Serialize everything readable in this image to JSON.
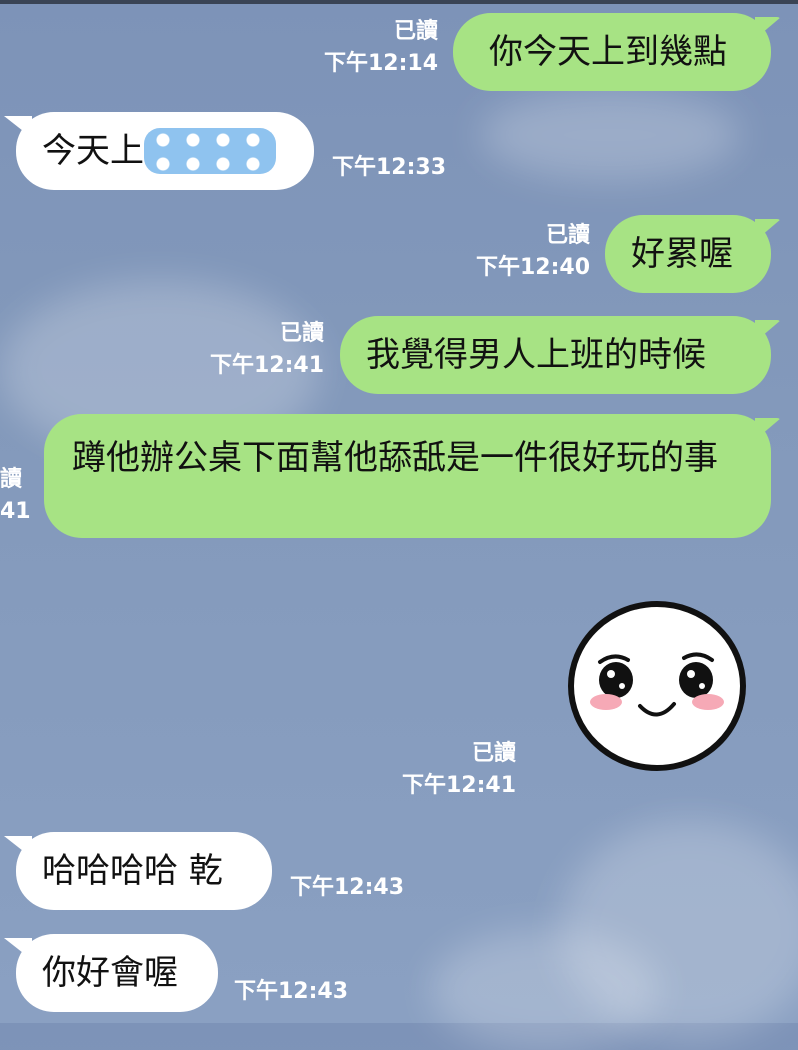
{
  "messages": [
    {
      "text": "你今天上到幾點",
      "read": "已讀",
      "time": "下午12:14"
    },
    {
      "text": "今天上",
      "time": "下午12:33"
    },
    {
      "text": "好累喔",
      "read": "已讀",
      "time": "下午12:40"
    },
    {
      "text": "我覺得男人上班的時候",
      "read": "已讀",
      "time": "下午12:41"
    },
    {
      "text": "蹲他辦公桌下面幫他舔舐是一件很好玩的事",
      "read_partial": "讀",
      "time_partial": "41"
    },
    {
      "sticker": "crying-face-sticker",
      "read": "已讀",
      "time": "下午12:41"
    },
    {
      "text": "哈哈哈哈 乾",
      "time": "下午12:43"
    },
    {
      "text": "你好會喔",
      "time": "下午12:43"
    }
  ],
  "colors": {
    "outgoing": "#a7e384",
    "incoming": "#ffffff",
    "background": "#8399bb"
  }
}
